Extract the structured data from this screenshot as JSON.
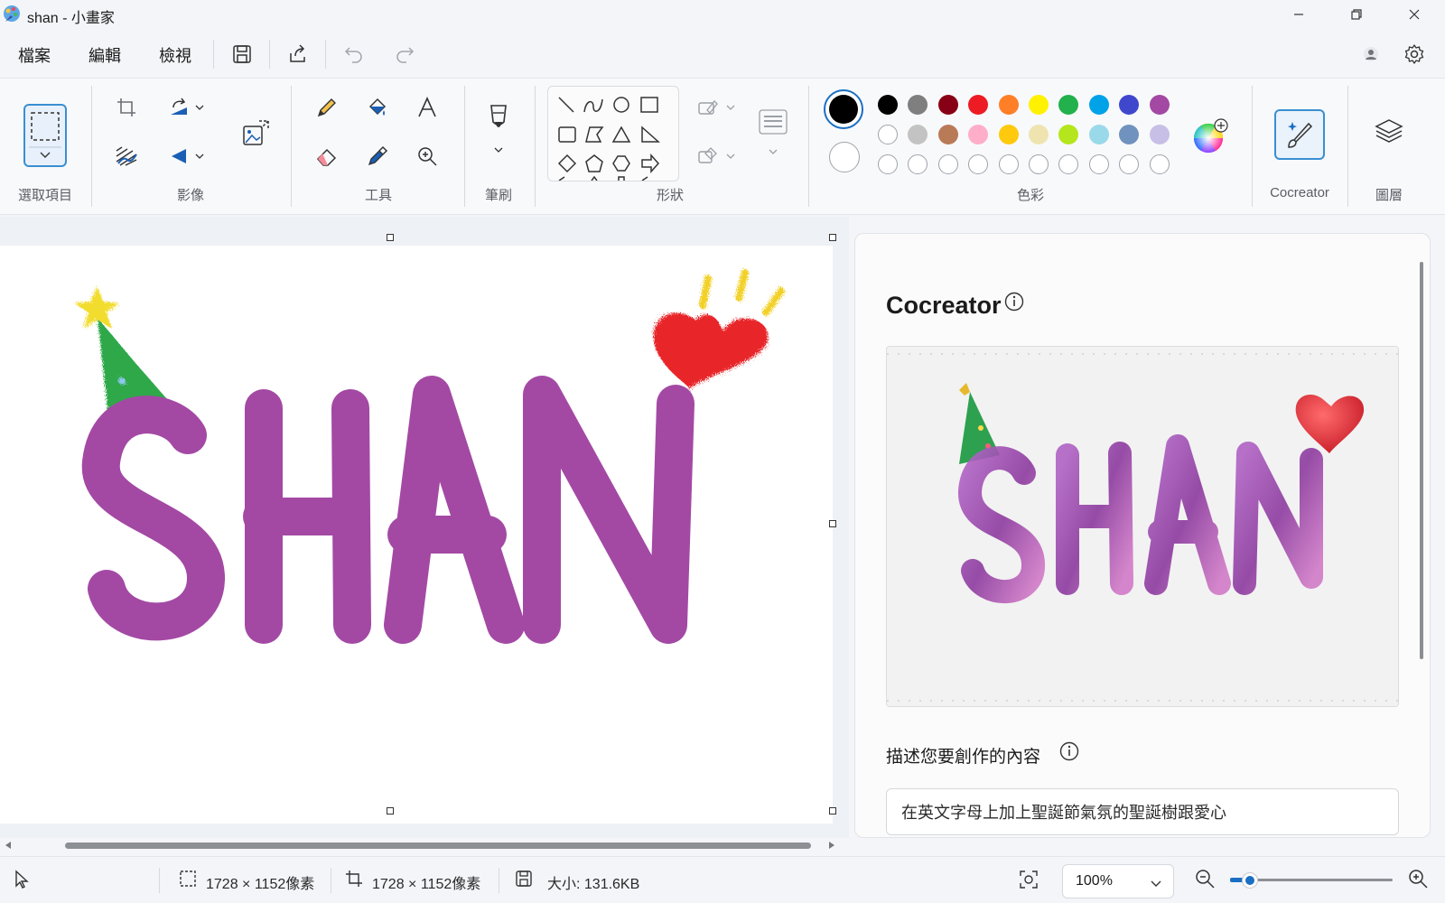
{
  "window": {
    "title": "shan - 小畫家",
    "controls": [
      "minimize-icon",
      "restore-icon",
      "close-icon"
    ]
  },
  "menu": {
    "file": "檔案",
    "edit": "編輯",
    "view": "檢視",
    "icons": [
      "save-icon",
      "share-icon",
      "undo-icon",
      "redo-icon",
      "account-icon",
      "gear-icon"
    ]
  },
  "ribbon": {
    "groups": {
      "selection": "選取項目",
      "image": "影像",
      "tools": "工具",
      "brushes": "筆刷",
      "shapes": "形狀",
      "colors": "色彩",
      "cocreator": "Cocreator",
      "layers": "圖層"
    },
    "colors": {
      "primary": "#000000",
      "secondary": "#ffffff",
      "row1": [
        "#000000",
        "#7f7f7f",
        "#880015",
        "#ed1c24",
        "#ff7f27",
        "#fff200",
        "#22b14c",
        "#00a2e8",
        "#3f48cc",
        "#a349a4"
      ],
      "row2": [
        "#ffffff",
        "#c3c3c3",
        "#b97a57",
        "#ffaec9",
        "#ffc90e",
        "#efe4b0",
        "#b5e61d",
        "#99d9ea",
        "#7092be",
        "#c8bfe7"
      ]
    }
  },
  "canvas": {
    "artwork_text": "SHAN",
    "artwork_color": "#a349a4"
  },
  "cocreator_panel": {
    "title": "Cocreator",
    "description_label": "描述您要創作的內容",
    "prompt_value": "在英文字母上加上聖誕節氣氛的聖誕樹跟愛心",
    "preview_text": "SHAN"
  },
  "status": {
    "selection_size": "1728 × 1152像素",
    "canvas_size": "1728 × 1152像素",
    "file_size": "大小: 131.6KB",
    "zoom": "100%",
    "zoom_level_fraction": 0.12
  }
}
